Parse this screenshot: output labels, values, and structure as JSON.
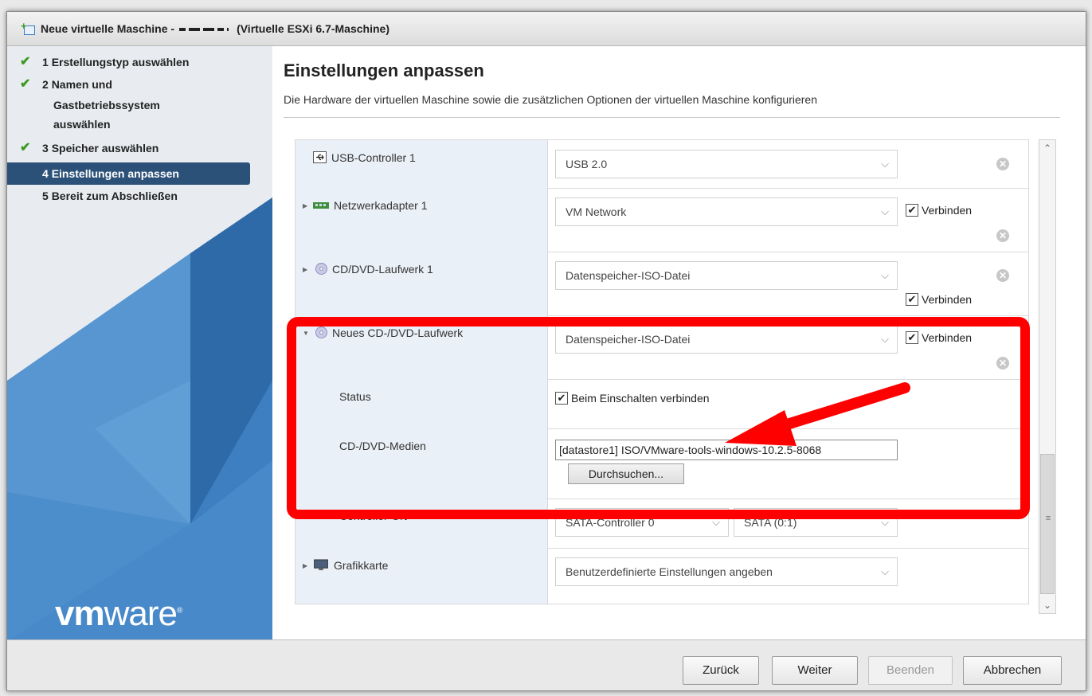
{
  "dialog": {
    "title_prefix": "Neue virtuelle Maschine -",
    "title_suffix": "(Virtuelle ESXi 6.7-Maschine)"
  },
  "steps": [
    {
      "num": "1",
      "label": "Erstellungstyp auswählen",
      "done": true
    },
    {
      "num": "2",
      "label": "Namen und",
      "label2": "Gastbetriebssystem",
      "label3": "auswählen",
      "done": true
    },
    {
      "num": "3",
      "label": "Speicher auswählen",
      "done": true
    },
    {
      "num": "4",
      "label": "Einstellungen anpassen",
      "done": true,
      "active": true
    },
    {
      "num": "5",
      "label": "Bereit zum Abschließen",
      "done": false
    }
  ],
  "brand": {
    "logo_bold": "vm",
    "logo_rest": "ware",
    "logo_mark": "®"
  },
  "main": {
    "title": "Einstellungen anpassen",
    "subtitle": "Die Hardware der virtuellen Maschine sowie die zusätzlichen Optionen der virtuellen Maschine konfigurieren"
  },
  "hardware": {
    "usb": {
      "label": "USB-Controller 1",
      "value": "USB 2.0"
    },
    "net": {
      "label": "Netzwerkadapter 1",
      "value": "VM Network",
      "connect": "Verbinden"
    },
    "cd1": {
      "label": "CD/DVD-Laufwerk 1",
      "value": "Datenspeicher-ISO-Datei",
      "connect": "Verbinden"
    },
    "newcd": {
      "label": "Neues CD-/DVD-Laufwerk",
      "value": "Datenspeicher-ISO-Datei",
      "connect": "Verbinden",
      "status_label": "Status",
      "status_value": "Beim Einschalten verbinden",
      "media_label": "CD-/DVD-Medien",
      "media_value": "[datastore1] ISO/VMware-tools-windows-10.2.5-8068",
      "browse": "Durchsuchen...",
      "controller_label": "Controller-Ort",
      "controller_value": "SATA-Controller 0",
      "port_value": "SATA (0:1)"
    },
    "gpu": {
      "label": "Grafikkarte",
      "value": "Benutzerdefinierte Einstellungen angeben"
    }
  },
  "footer": {
    "back": "Zurück",
    "next": "Weiter",
    "finish": "Beenden",
    "cancel": "Abbrechen"
  },
  "colors": {
    "highlight": "#ff0000",
    "active_step": "#2c5178",
    "check": "#3a9a23"
  }
}
